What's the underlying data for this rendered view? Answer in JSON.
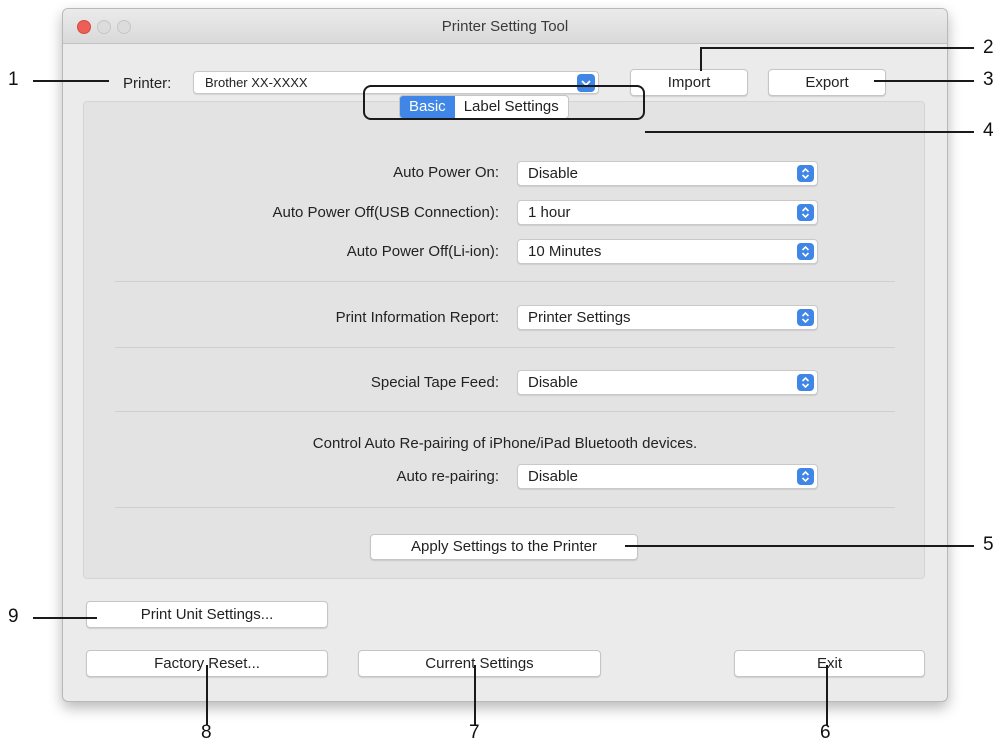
{
  "window": {
    "title": "Printer Setting Tool"
  },
  "printer": {
    "label": "Printer:",
    "value": "Brother XX-XXXX"
  },
  "toolbar": {
    "import_label": "Import",
    "export_label": "Export"
  },
  "tabs": [
    {
      "label": "Basic",
      "active": true
    },
    {
      "label": "Label Settings",
      "active": false
    }
  ],
  "settings": {
    "auto_power_on": {
      "label": "Auto Power On:",
      "value": "Disable"
    },
    "auto_power_off_usb": {
      "label": "Auto Power Off(USB Connection):",
      "value": "1 hour"
    },
    "auto_power_off_liion": {
      "label": "Auto Power Off(Li-ion):",
      "value": "10 Minutes"
    },
    "print_info_report": {
      "label": "Print Information Report:",
      "value": "Printer Settings"
    },
    "special_tape_feed": {
      "label": "Special Tape Feed:",
      "value": "Disable"
    },
    "auto_repairing_note": "Control Auto Re-pairing of iPhone/iPad Bluetooth devices.",
    "auto_repairing": {
      "label": "Auto re-pairing:",
      "value": "Disable"
    }
  },
  "apply_label": "Apply Settings to the Printer",
  "buttons": {
    "print_unit_settings": "Print Unit Settings...",
    "factory_reset": "Factory Reset...",
    "current_settings": "Current Settings",
    "exit": "Exit"
  },
  "callouts": [
    "1",
    "2",
    "3",
    "4",
    "5",
    "6",
    "7",
    "8",
    "9"
  ],
  "colors": {
    "accent": "#3f86e6",
    "close": "#ec5f56"
  }
}
